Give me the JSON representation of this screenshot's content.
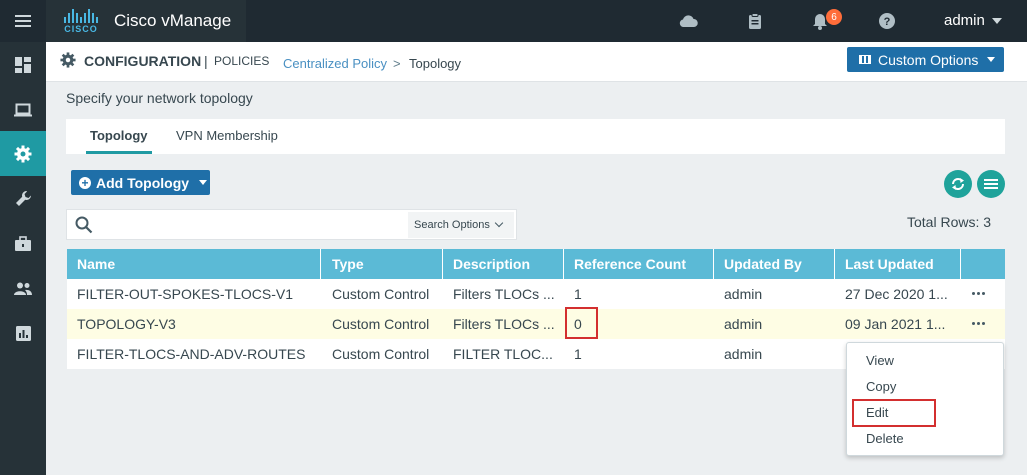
{
  "app": {
    "brand_word": "CISCO",
    "title": "Cisco vManage",
    "user": "admin",
    "alerts_count": "6"
  },
  "header": {
    "section": "CONFIGURATION",
    "separator": "|",
    "subsection": "POLICIES",
    "breadcrumb_link": "Centralized Policy",
    "breadcrumb_sep": ">",
    "breadcrumb_current": "Topology",
    "custom_options": "Custom Options"
  },
  "page": {
    "title": "Specify your network topology"
  },
  "tabs": [
    {
      "label": "Topology",
      "active": true
    },
    {
      "label": "VPN Membership",
      "active": false
    }
  ],
  "toolbar": {
    "add_label": "Add Topology",
    "total_rows": "Total Rows: 3"
  },
  "search": {
    "placeholder": "",
    "options_label": "Search Options"
  },
  "table": {
    "columns": [
      "Name",
      "Type",
      "Description",
      "Reference Count",
      "Updated By",
      "Last Updated"
    ],
    "rows": [
      {
        "name": "FILTER-OUT-SPOKES-TLOCS-V1",
        "type": "Custom Control",
        "description": "Filters TLOCs ...",
        "ref": "1",
        "by": "admin",
        "updated": "27 Dec 2020 1..."
      },
      {
        "name": "TOPOLOGY-V3",
        "type": "Custom Control",
        "description": "Filters TLOCs ...",
        "ref": "0",
        "by": "admin",
        "updated": "09 Jan 2021 1..."
      },
      {
        "name": "FILTER-TLOCS-AND-ADV-ROUTES",
        "type": "Custom Control",
        "description": "FILTER TLOC...",
        "ref": "1",
        "by": "admin",
        "updated": ""
      }
    ]
  },
  "context_menu": [
    "View",
    "Copy",
    "Edit",
    "Delete"
  ],
  "colors": {
    "accent": "#1f9aa3",
    "primary_button": "#1f6fa8",
    "table_header": "#5bbad6",
    "highlight_row": "#fefde4",
    "callout_red": "#d32f2f"
  }
}
